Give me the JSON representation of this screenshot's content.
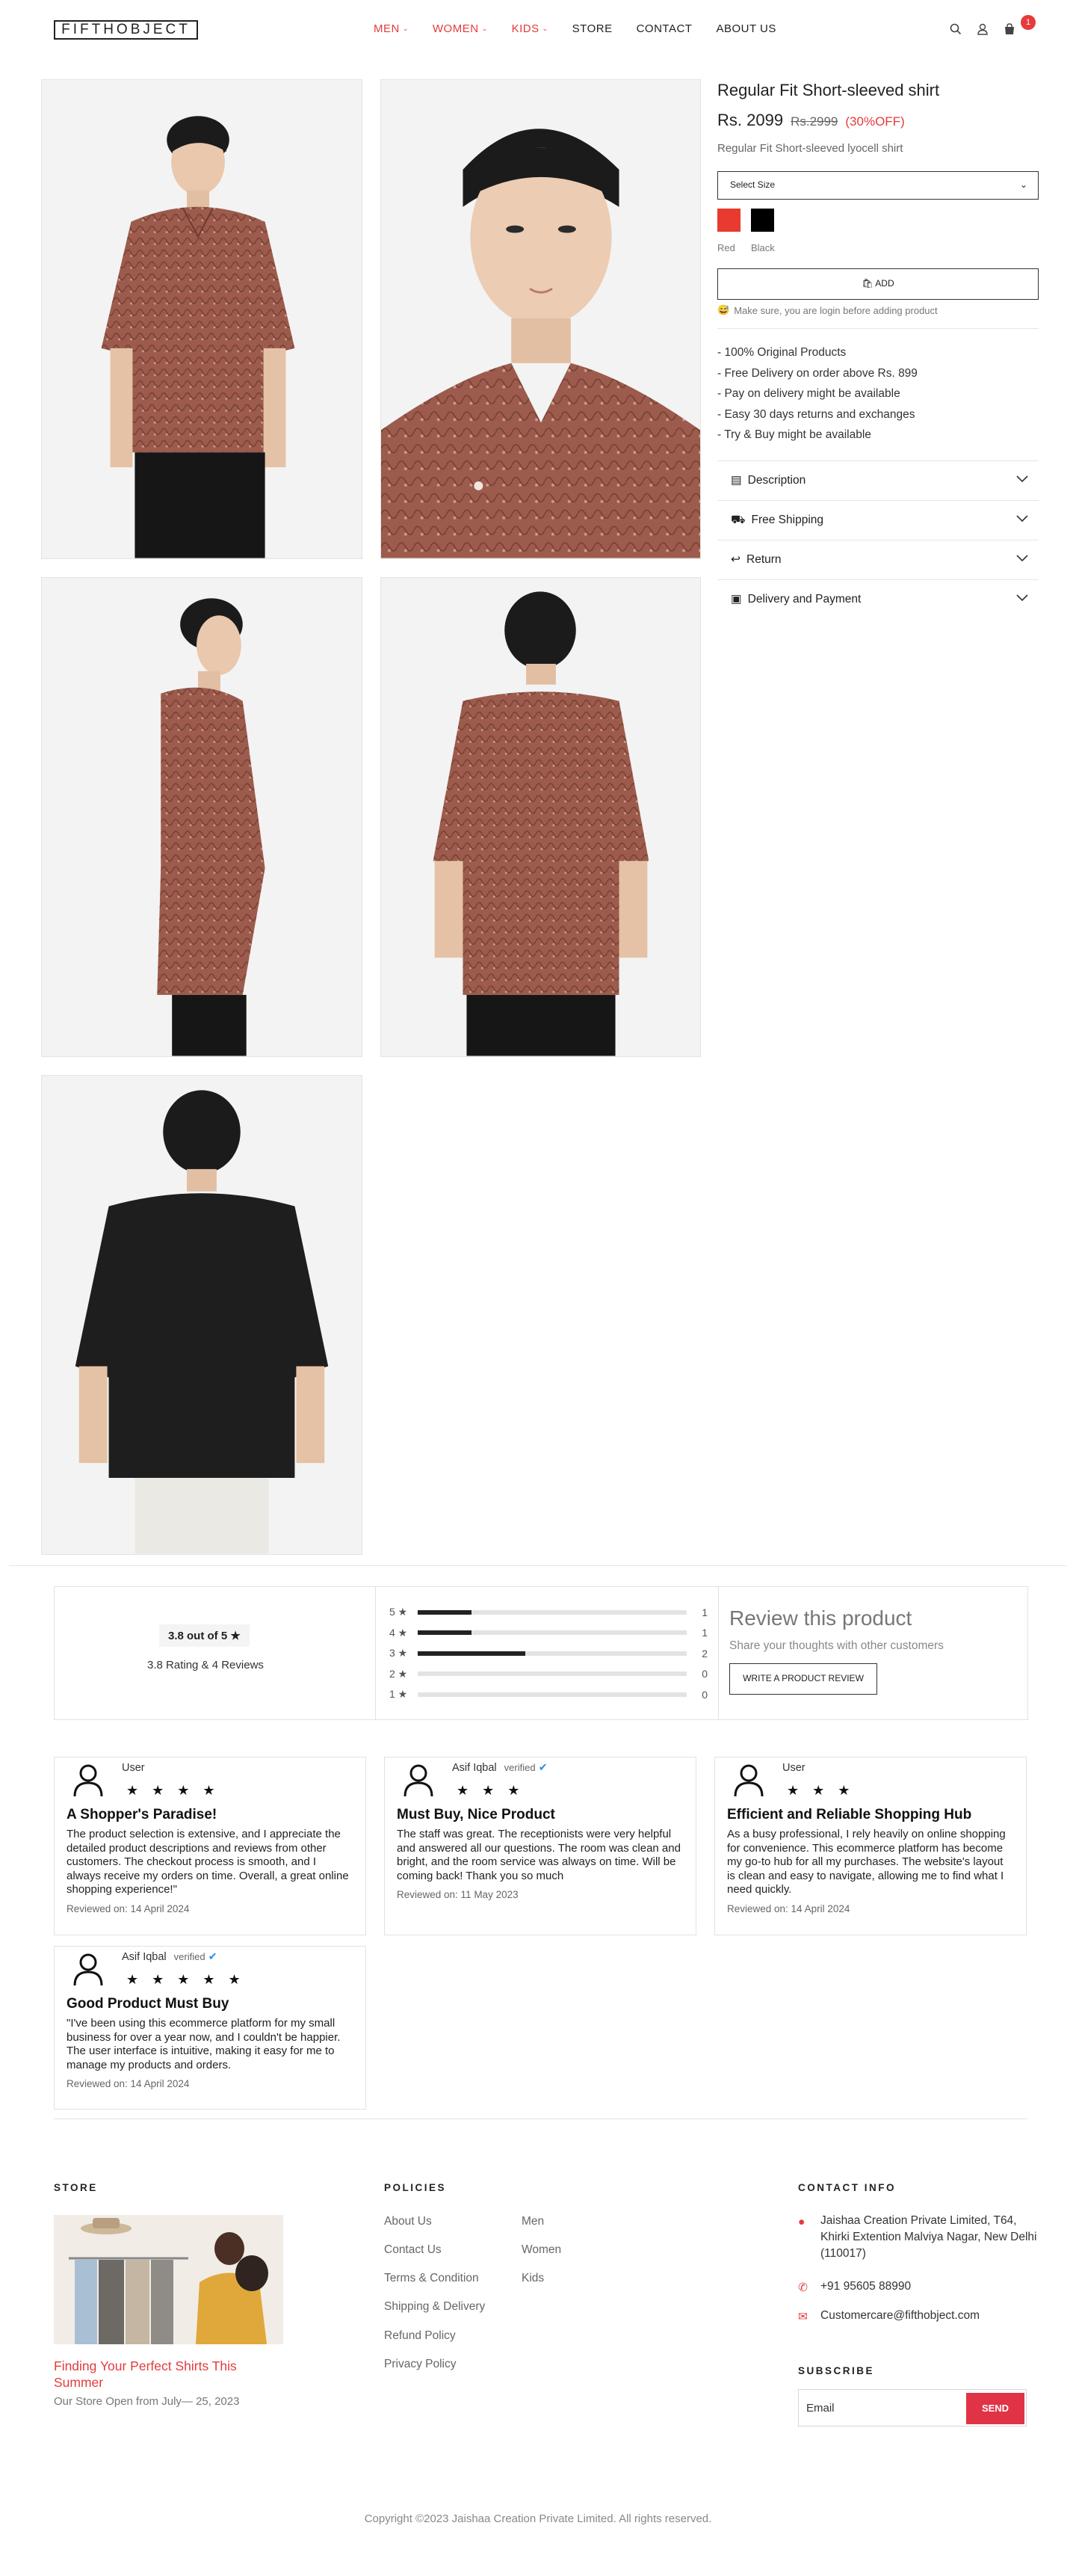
{
  "header": {
    "logo": "FIFTHOBJECT",
    "nav": [
      {
        "label": "MEN",
        "dropdown": true,
        "highlight": true
      },
      {
        "label": "WOMEN",
        "dropdown": true,
        "highlight": true
      },
      {
        "label": "KIDS",
        "dropdown": true,
        "highlight": true
      },
      {
        "label": "STORE",
        "dropdown": false,
        "highlight": false
      },
      {
        "label": "CONTACT",
        "dropdown": false,
        "highlight": false
      },
      {
        "label": "ABOUT US",
        "dropdown": false,
        "highlight": false
      }
    ],
    "icons": [
      "search-icon",
      "user-icon",
      "cart-icon"
    ],
    "cart_count": "1"
  },
  "gallery": [
    {
      "view": "front-full"
    },
    {
      "view": "closeup"
    },
    {
      "view": "side"
    },
    {
      "view": "back"
    },
    {
      "view": "back-black-variant"
    }
  ],
  "product": {
    "title": "Regular Fit Short-sleeved shirt",
    "price": "Rs. 2099",
    "old_price": "Rs.2999",
    "discount": "(30%OFF)",
    "subtitle": "Regular Fit Short-sleeved lyocell shirt",
    "size_select": "Select Size",
    "colors": [
      {
        "label": "Red",
        "hex": "#e83a2e"
      },
      {
        "label": "Black",
        "hex": "#000000"
      }
    ],
    "add_label": "ADD",
    "login_note": "Make sure, you are login before adding product",
    "features": [
      "- 100% Original Products",
      "- Free Delivery on order above Rs. 899",
      "- Pay on delivery might be available",
      "- Easy 30 days returns and exchanges",
      "- Try & Buy might be available"
    ],
    "accordion": [
      {
        "label": "Description",
        "icon": "shirt-icon"
      },
      {
        "label": "Free Shipping",
        "icon": "truck-icon"
      },
      {
        "label": "Return",
        "icon": "return-icon"
      },
      {
        "label": "Delivery and Payment",
        "icon": "box-icon"
      }
    ]
  },
  "ratings": {
    "score": "3.8 out of 5 ★",
    "summary": "3.8 Rating & 4  Reviews",
    "bars": [
      {
        "label": "5 ★",
        "fraction": 0.2,
        "count": "1"
      },
      {
        "label": "4 ★",
        "fraction": 0.2,
        "count": "1"
      },
      {
        "label": "3 ★",
        "fraction": 0.4,
        "count": "2"
      },
      {
        "label": "2 ★",
        "fraction": 0.0,
        "count": "0"
      },
      {
        "label": "1 ★",
        "fraction": 0.0,
        "count": "0"
      }
    ],
    "cta_title": "Review this product",
    "cta_sub": "Share your thoughts with other customers",
    "cta_button": "WRITE A PRODUCT REVIEW"
  },
  "reviews": [
    {
      "name": "User",
      "verified": "",
      "stars": 4,
      "title": "A Shopper's Paradise!",
      "text": "The product selection is extensive, and I appreciate the detailed product descriptions and reviews from other customers. The checkout process is smooth, and I always receive my orders on time. Overall, a great online shopping experience!\"",
      "date": "Reviewed on: 14 April 2024"
    },
    {
      "name": "Asif Iqbal",
      "verified": "verified",
      "stars": 3,
      "title": "Must Buy, Nice Product",
      "text": "The staff was great. The receptionists were very helpful and answered all our questions. The room was clean and bright, and the room service was always on time. Will be coming back! Thank you so much",
      "date": "Reviewed on: 11 May 2023"
    },
    {
      "name": "User",
      "verified": "",
      "stars": 3,
      "title": "Efficient and Reliable Shopping Hub",
      "text": "As a busy professional, I rely heavily on online shopping for convenience. This ecommerce platform has become my go-to hub for all my purchases. The website's layout is clean and easy to navigate, allowing me to find what I need quickly.",
      "date": "Reviewed on: 14 April 2024"
    },
    {
      "name": "Asif Iqbal",
      "verified": "verified",
      "stars": 5,
      "title": "Good Product Must Buy",
      "text": "\"I've been using this ecommerce platform for my small business for over a year now, and I couldn't be happier. The user interface is intuitive, making it easy for me to manage my products and orders.",
      "date": "Reviewed on: 14 April 2024"
    }
  ],
  "footer": {
    "store_heading": "STORE",
    "store_title": "Finding Your Perfect Shirts This Summer",
    "store_date": "Our Store Open from July— 25, 2023",
    "policies_heading": "POLICIES",
    "policies_col1": [
      "About Us",
      "Contact Us",
      "Terms & Condition",
      "Shipping & Delivery",
      "Refund Policy",
      "Privacy Policy"
    ],
    "policies_col2": [
      "Men",
      "Women",
      "Kids"
    ],
    "contact_heading": "CONTACT INFO",
    "address": "Jaishaa Creation Private Limited, T64, Khirki Extention Malviya Nagar, New Delhi (110017)",
    "phone": "+91 95605 88990",
    "email": "Customercare@fifthobject.com",
    "subscribe_heading": "SUBSCRIBE",
    "email_placeholder": "Email",
    "send_label": "SEND",
    "copyright": "Copyright ©2023 Jaishaa Creation Private Limited. All rights reserved.",
    "accent": "#e53b3b"
  }
}
